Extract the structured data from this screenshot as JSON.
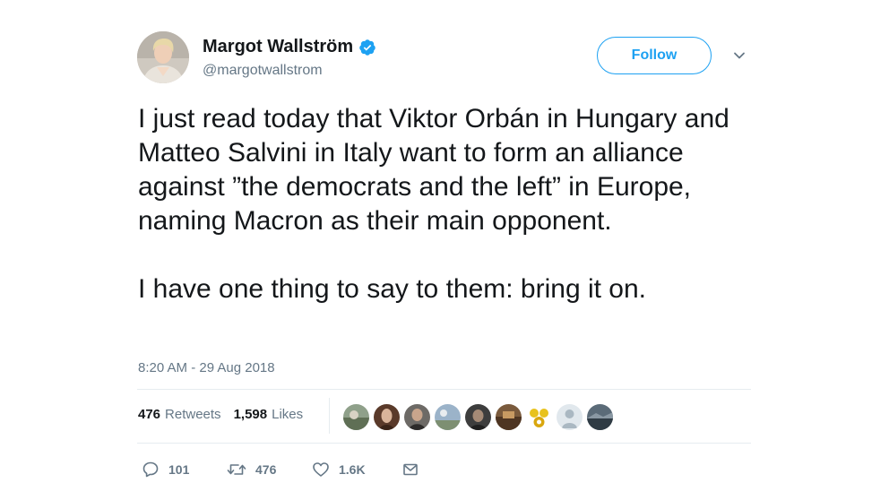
{
  "user": {
    "display_name": "Margot Wallström",
    "handle": "@margotwallstrom",
    "verified": true,
    "avatar_icon": "profile-photo",
    "verified_icon": "verified-badge-icon"
  },
  "follow_button": {
    "label": "Follow"
  },
  "menu_icon": "chevron-down-icon",
  "tweet": {
    "paragraphs": [
      "I just read today that Viktor Orbán in Hungary and Matteo Salvini in Italy want to form an alliance against ”the democrats and the left” in Europe, naming Macron as their main opponent.",
      "I have one thing to say to them: bring it on."
    ],
    "timestamp": "8:20 AM - 29 Aug 2018"
  },
  "stats": {
    "retweets_count": "476",
    "retweets_label": "Retweets",
    "likes_count": "1,598",
    "likes_label": "Likes"
  },
  "liker_avatars": [
    "avatar-1",
    "avatar-2",
    "avatar-3",
    "avatar-4",
    "avatar-5",
    "avatar-6",
    "avatar-7",
    "avatar-8",
    "avatar-9"
  ],
  "actions": {
    "reply_count": "101",
    "retweet_count": "476",
    "like_count": "1.6K",
    "reply_icon": "reply-icon",
    "retweet_icon": "retweet-icon",
    "like_icon": "heart-icon",
    "dm_icon": "envelope-icon"
  },
  "colors": {
    "accent": "#1da1f2",
    "text_primary": "#14171a",
    "text_secondary": "#657786",
    "divider": "#e6ecf0"
  }
}
